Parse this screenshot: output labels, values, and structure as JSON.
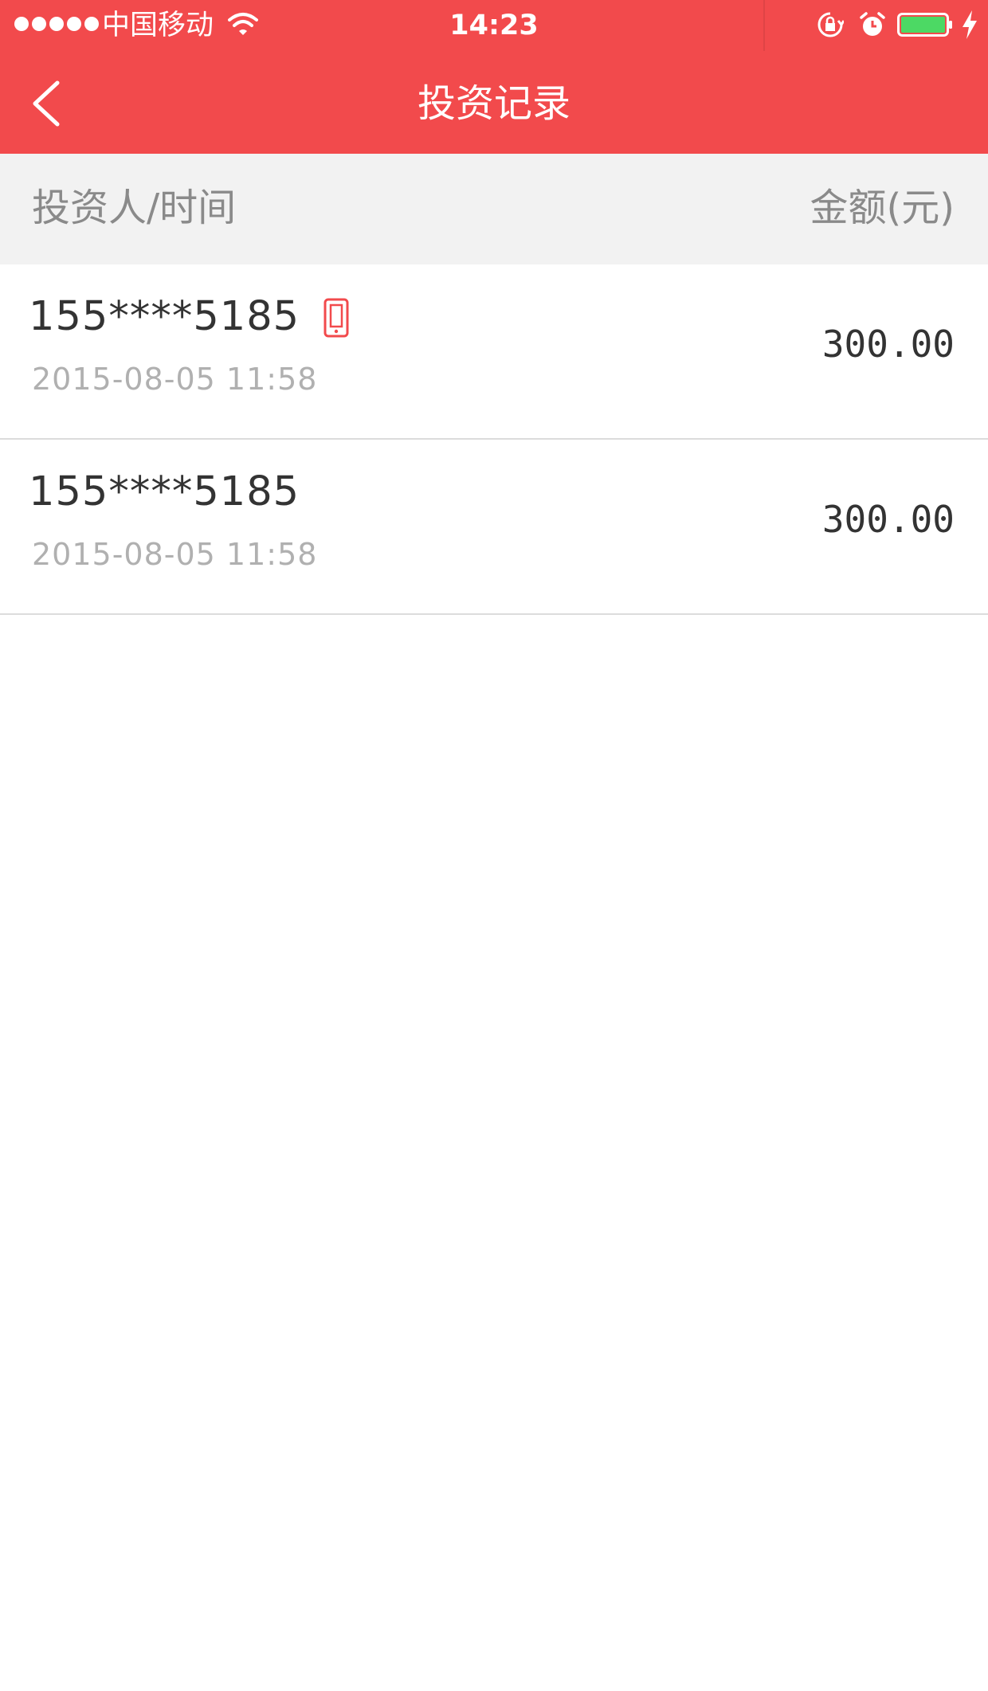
{
  "status_bar": {
    "carrier": "中国移动",
    "time": "14:23",
    "icons": [
      "signal-dots",
      "wifi-icon",
      "rotation-lock-icon",
      "alarm-icon",
      "battery-icon",
      "charging-icon"
    ]
  },
  "nav": {
    "title": "投资记录",
    "back_icon": "chevron-left-icon"
  },
  "list_header": {
    "left": "投资人/时间",
    "right": "金额(元)"
  },
  "records": [
    {
      "investor": "155****5185",
      "time": "2015-08-05 11:58",
      "amount": "300.00",
      "device_icon": "mobile-phone-icon"
    },
    {
      "investor": "155****5185",
      "time": "2015-08-05 11:58",
      "amount": "300.00"
    }
  ],
  "colors": {
    "brand": "#f24a4c",
    "header_bg": "#f2f2f2",
    "battery": "#4cd964"
  }
}
